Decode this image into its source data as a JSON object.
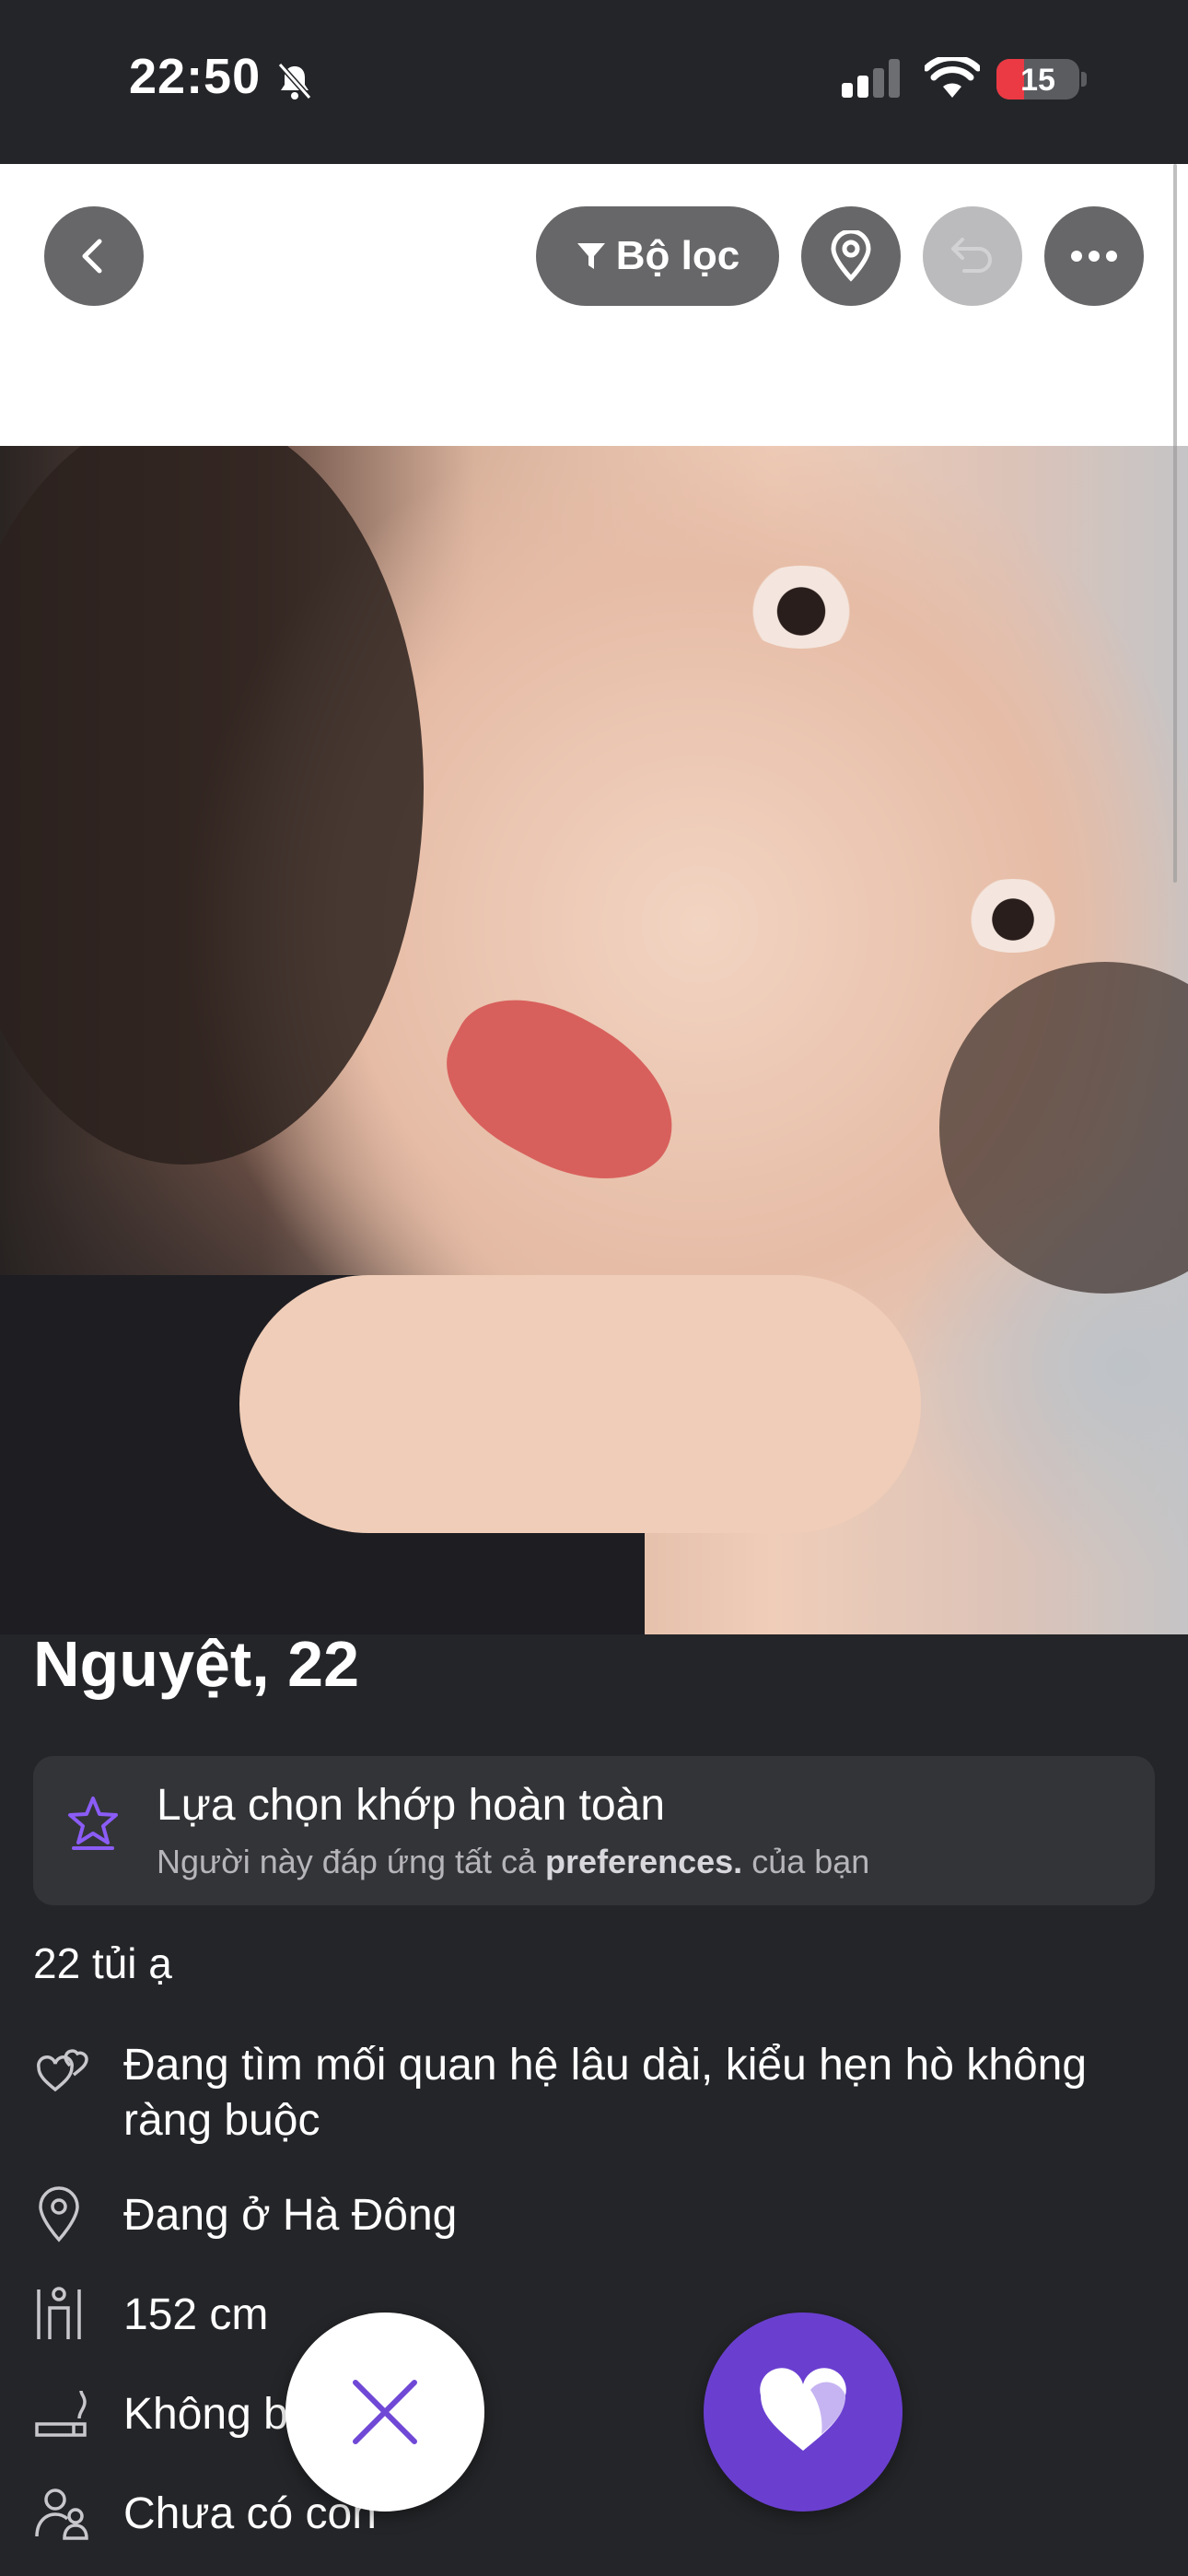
{
  "status_bar": {
    "time": "22:50",
    "battery": "15",
    "battery_level": 0.15,
    "icons": [
      "bell-slash-icon",
      "cellular-signal-icon",
      "wifi-icon",
      "battery-icon"
    ]
  },
  "toolbar": {
    "back_icon": "chevron-left-icon",
    "filter_label": "Bộ lọc",
    "filter_icon": "funnel-icon",
    "location_icon": "map-pin-icon",
    "undo_icon": "undo-icon",
    "more_icon": "ellipsis-icon"
  },
  "profile": {
    "name_age": "Nguyệt, 22",
    "photo_alt": "profile-photo",
    "match_card": {
      "icon": "star-icon",
      "title": "Lựa chọn khớp hoàn toàn",
      "subtitle_prefix": "Người này đáp ứng tất cả",
      "subtitle_bold": "preferences.",
      "subtitle_suffix": "của bạn"
    },
    "bio": "22 tủi ạ",
    "details": [
      {
        "icon": "hearts-icon",
        "text": "Đang tìm mối quan hệ lâu dài, kiểu hẹn hò không ràng buộc"
      },
      {
        "icon": "map-pin-icon",
        "text": "Đang ở Hà Đông"
      },
      {
        "icon": "height-icon",
        "text": "152 cm"
      },
      {
        "icon": "smoking-icon",
        "text": "Không b"
      },
      {
        "icon": "children-icon",
        "text": "Chưa có con"
      }
    ]
  },
  "actions": {
    "pass_icon": "x-icon",
    "like_icon": "heart-icon"
  },
  "colors": {
    "background": "#242528",
    "card": "#333437",
    "accent": "#6a3fd0",
    "battery_low": "#eb3a44"
  }
}
